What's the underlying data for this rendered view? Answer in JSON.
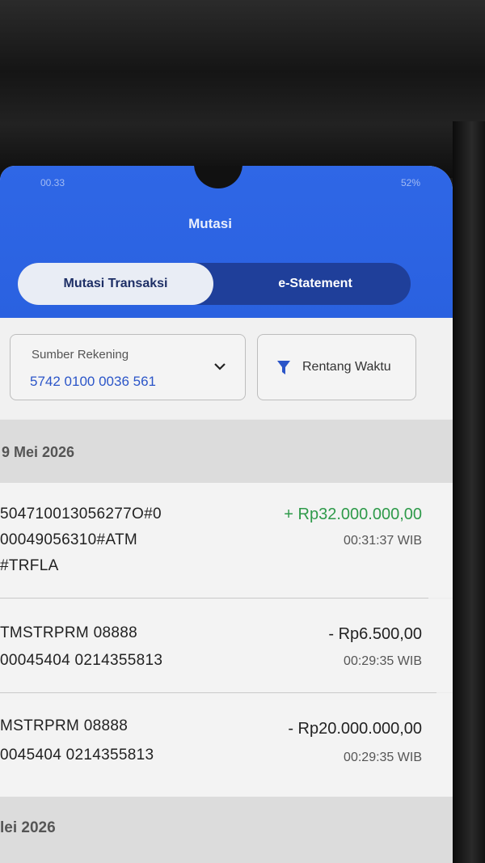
{
  "status_bar": {
    "time": "00.33",
    "battery": "52%"
  },
  "header": {
    "title": "Mutasi"
  },
  "tabs": [
    {
      "label": "Mutasi Transaksi",
      "active": true
    },
    {
      "label": "e-Statement",
      "active": false
    }
  ],
  "filter": {
    "account_label": "Sumber Rekening",
    "account_number": "5742 0100 0036 561",
    "time_range_label": "Rentang Waktu"
  },
  "groups": [
    {
      "date": "9 Mei 2026",
      "transactions": [
        {
          "lines": [
            "504710013056277O#0",
            "00049056310#ATM",
            "#TRFLA"
          ],
          "amount": "+ Rp32.000.000,00",
          "time": "00:31:37 WIB",
          "type": "credit"
        },
        {
          "lines": [
            "TMSTRPRM 08888",
            "00045404 0214355813"
          ],
          "amount": "- Rp6.500,00",
          "time": "00:29:35 WIB",
          "type": "debit"
        },
        {
          "lines": [
            "MSTRPRM 08888",
            "0045404 0214355813"
          ],
          "amount": "- Rp20.000.000,00",
          "time": "00:29:35 WIB",
          "type": "debit"
        }
      ]
    },
    {
      "date": "lei 2026"
    }
  ],
  "colors": {
    "header_blue": "#2f67e6",
    "credit_green": "#2e9a4a",
    "account_blue": "#2b55c8"
  }
}
